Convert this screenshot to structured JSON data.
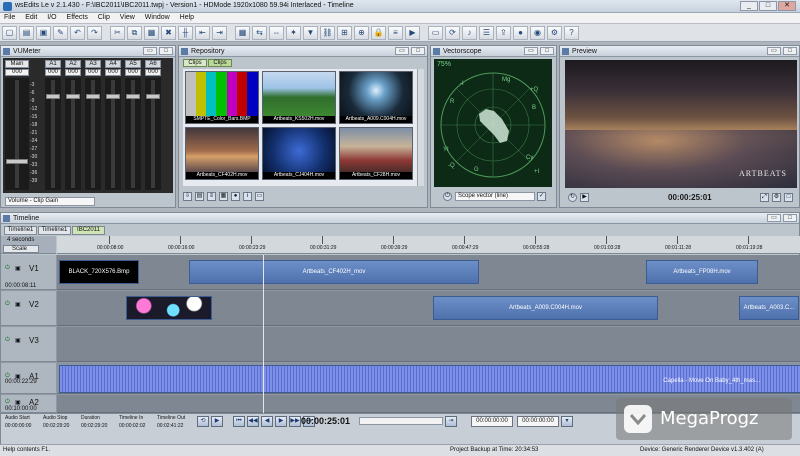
{
  "window": {
    "title": "wsEdits Le v 2.1.430 - F:\\IBC2011\\IBC2011.twpj - Version1 - HDMode 1920x1080 59.94i Interlaced - Timeline",
    "min": "_",
    "max": "□",
    "close": "✕"
  },
  "menu": [
    "File",
    "Edit",
    "I/O",
    "Effects",
    "Clip",
    "View",
    "Window",
    "Help"
  ],
  "toolbar_icons": [
    "new-icon",
    "open-icon",
    "save-icon",
    "wrench-icon",
    "undo-icon",
    "redo-icon",
    "cut-icon",
    "copy-icon",
    "paste-icon",
    "delete-icon",
    "split-icon",
    "mark-in-icon",
    "mark-out-icon",
    "grid-icon",
    "ripple-icon",
    "slip-icon",
    "effect-icon",
    "marker-icon",
    "link-icon",
    "snap-icon",
    "zoom-icon",
    "lock-icon",
    "track-icon",
    "render-icon",
    "monitor-icon",
    "sync-icon",
    "audio-icon",
    "mixer-icon",
    "export-icon",
    "capture-icon",
    "record-icon",
    "settings-icon",
    "help-icon"
  ],
  "vumeter": {
    "title": "VUMeter",
    "channels": [
      "Main",
      "A1",
      "A2",
      "A3",
      "A4",
      "A5",
      "A6"
    ],
    "values": [
      "000",
      "000",
      "000",
      "000",
      "000",
      "000",
      "000"
    ],
    "knob_levels": [
      0.22,
      0.85,
      0.85,
      0.85,
      0.85,
      0.85,
      0.85
    ],
    "scale": [
      "-3",
      "-6",
      "-9",
      "-12",
      "-15",
      "-18",
      "-21",
      "-24",
      "-27",
      "-30",
      "-33",
      "-36",
      "-39"
    ],
    "mode_select": "Volume - Clip Gain"
  },
  "repository": {
    "title": "Repository",
    "tabs": [
      "Clips",
      "Clips"
    ],
    "clips": [
      {
        "label": "SMPTE_Color_Bars.BMP",
        "thumb": "colorbars"
      },
      {
        "label": "Artbeats_KS502H.mov",
        "thumb": "green"
      },
      {
        "label": "Artbeats_A009.C004H.mov",
        "thumb": "fractal"
      },
      {
        "label": "Artbeats_CF402H.mov",
        "thumb": "sunset"
      },
      {
        "label": "Artbeats_CJ404H.mov",
        "thumb": "blue"
      },
      {
        "label": "Artbeats_CF28H.mov",
        "thumb": "crowd"
      }
    ]
  },
  "vectorscope": {
    "title": "Vectorscope",
    "percent": "75%",
    "mode_select": "Scope vector (line)",
    "labels": [
      "R",
      "Mg",
      "B",
      "Cy",
      "G",
      "YI",
      "-I",
      "+Q",
      "-Q",
      "+I"
    ]
  },
  "preview": {
    "title": "Preview",
    "timecode": "00:00:25:01",
    "watermark": "ARTBEATS"
  },
  "timeline": {
    "title": "Timeline",
    "tabs": [
      "Timeline1",
      "Timeline1",
      "IBC2011"
    ],
    "zoom_label": "4 seconds",
    "scale_label": "Scale",
    "ruler": [
      "00:00:08:00",
      "00:00:16:00",
      "00:00:23:29",
      "00:00:31:29",
      "00:00:39:29",
      "00:00:47:29",
      "00:00:55:28",
      "00:01:03:28",
      "00:01:11:28",
      "00:01:19:28"
    ],
    "head_timecode": "00:00:08:11",
    "audio_timecode": "00:00:22:29",
    "bottom_timecode": "00:10:00:00",
    "tracks": [
      {
        "name": "V1",
        "clips": [
          {
            "label": "BLACK_720X576.Bmp",
            "style": "black"
          },
          {
            "label": "Artbeats_CF402H_mov",
            "style": "blue"
          },
          {
            "label": "Artbeats_FP08H.mov",
            "style": "blue"
          }
        ]
      },
      {
        "name": "V2",
        "clips": [
          {
            "label": "",
            "style": "bokeh"
          },
          {
            "label": "Artbeats_A009.C004H.mov",
            "style": "blue"
          },
          {
            "label": "Artbeats_A003.C...",
            "style": "blue"
          }
        ]
      },
      {
        "name": "V3",
        "clips": []
      },
      {
        "name": "A1",
        "clips": [
          {
            "label": "Capella - Move On Baby_4th_mas...",
            "style": "audio"
          }
        ]
      },
      {
        "name": "A2",
        "clips": []
      }
    ]
  },
  "transport": {
    "columns": [
      "Audio Start",
      "Audio Stop",
      "Duration",
      "Timeline In",
      "Timeline Out"
    ],
    "values": [
      "00:00:00:00",
      "00:02:29:20",
      "00:02:29:20",
      "00:00:02:02",
      "00:02:41:22"
    ],
    "current_timecode": "00:00:25:01",
    "in_box": "00:00:00:00",
    "out_box": "00:00:00:00"
  },
  "status": {
    "left": "Help contents  F1.",
    "middle": "Project Backup at Time: 20:34:53",
    "right": "Device: Generic Renderer Device v1.3.402 (A)"
  },
  "overlay": {
    "brand": "MegaProgz"
  }
}
